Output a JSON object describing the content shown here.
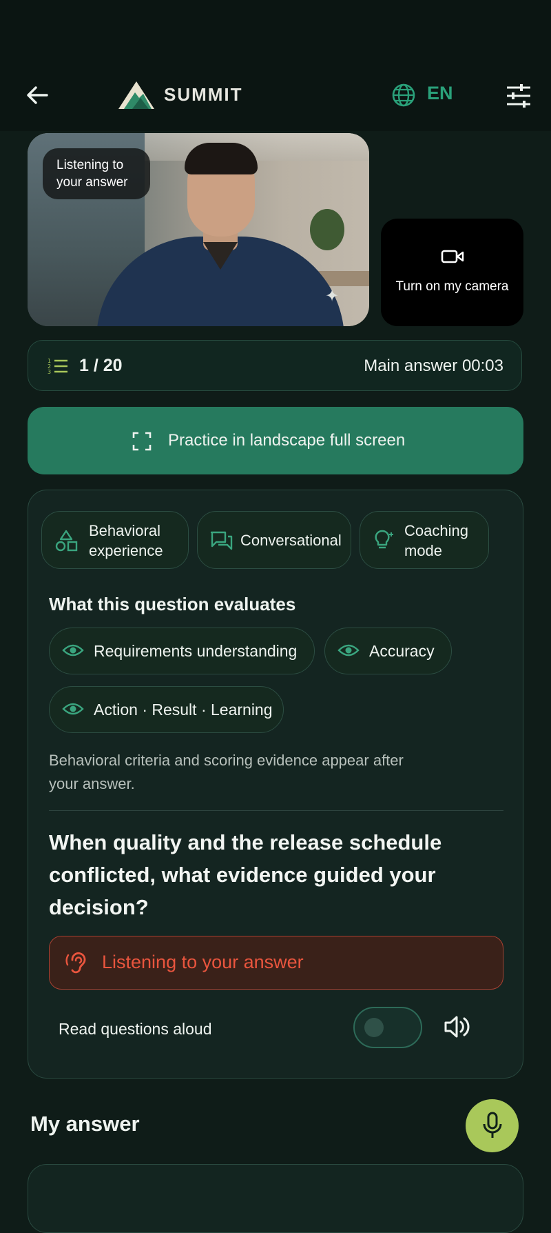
{
  "header": {
    "brand": "SUMMIT",
    "language": "EN",
    "icons": {
      "back": "arrow-left-icon",
      "logo": "mountain-logo",
      "globe": "globe-icon",
      "settings": "tune-icon"
    }
  },
  "video": {
    "status_overlay": "Listening to your answer",
    "camera_button_label": "Turn on my camera"
  },
  "progress": {
    "counter": "1 / 20",
    "timer": "Main answer 00:03"
  },
  "landscape_button": {
    "label": "Practice in landscape full screen"
  },
  "modes": [
    {
      "label": "Behavioral experience",
      "icon": "shapes-icon"
    },
    {
      "label": "Conversational",
      "icon": "chat-icon"
    },
    {
      "label": "Coaching mode",
      "icon": "lightbulb-icon"
    }
  ],
  "evaluates": {
    "title": "What this question evaluates",
    "criteria": [
      "Requirements understanding",
      "Accuracy",
      "Action · Result · Learning"
    ],
    "note": "Behavioral criteria and scoring evidence appear after your answer."
  },
  "question": "When quality and the release schedule conflicted, what evidence guided your decision?",
  "listening_banner": "Listening to your answer",
  "read_aloud": {
    "label": "Read questions aloud",
    "enabled": false
  },
  "answer": {
    "title": "My answer"
  },
  "colors": {
    "accent": "#267a5e",
    "alert": "#e9553e",
    "mic": "#a9c85a",
    "background": "#0f1c18"
  }
}
